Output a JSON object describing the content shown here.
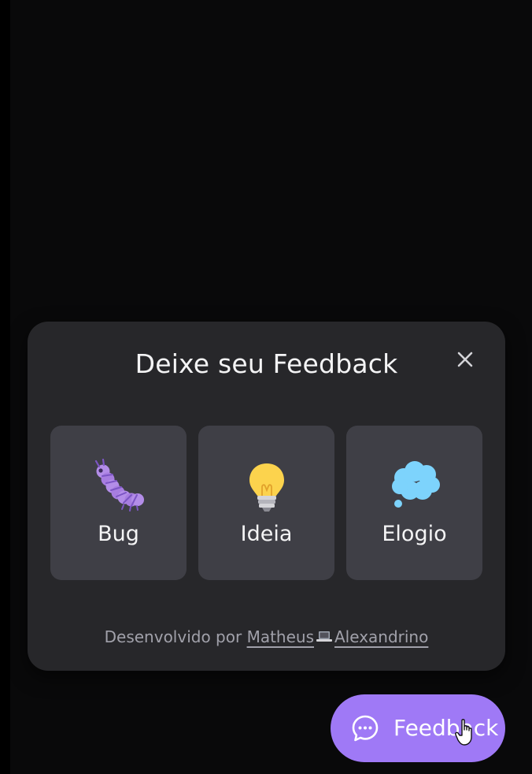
{
  "widget": {
    "title": "Deixe seu Feedback",
    "close_icon": "close-icon",
    "options": [
      {
        "label": "Bug",
        "icon": "caterpillar-icon"
      },
      {
        "label": "Ideia",
        "icon": "lightbulb-icon"
      },
      {
        "label": "Elogio",
        "icon": "thought-bubble-icon"
      }
    ],
    "footer": {
      "prefix": "Desenvolvido por ",
      "author_first": "Matheus",
      "author_icon": "laptop-icon",
      "author_last": "Alexandrino"
    }
  },
  "fab": {
    "label": "Feedback",
    "icon": "chat-bubble-icon"
  },
  "colors": {
    "background": "#09090a",
    "widget_bg": "#27272a",
    "option_bg": "#3f3f46",
    "accent": "#9f79f6",
    "text": "#f4f4f5",
    "muted_text": "#a1a1aa"
  }
}
